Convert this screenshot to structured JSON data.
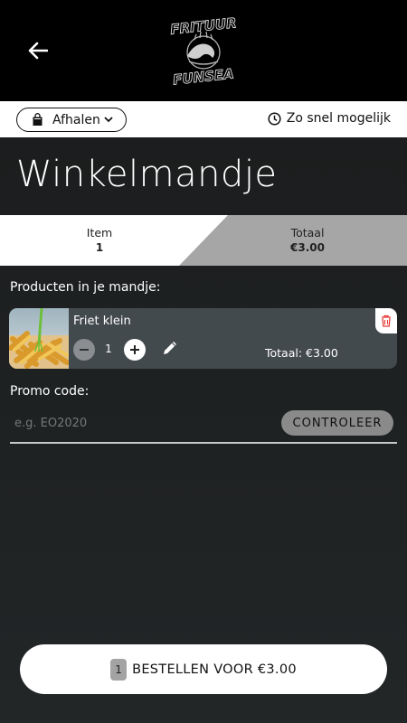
{
  "header": {
    "logo_top_text": "FRITUUR",
    "logo_bottom_text": "FUNSEA"
  },
  "options": {
    "pickup_label": "Afhalen",
    "time_label": "Zo snel mogelijk"
  },
  "page": {
    "title": "Winkelmandje"
  },
  "summary": {
    "item_label": "Item",
    "item_count": "1",
    "total_label": "Totaal",
    "total_value": "€3.00"
  },
  "products": {
    "section_label": "Producten in je mandje:",
    "items": [
      {
        "name": "Friet klein",
        "quantity": "1",
        "total": "Totaal: €3.00"
      }
    ]
  },
  "promo": {
    "label": "Promo code:",
    "placeholder": "e.g. EO2020",
    "check_label": "CONTROLEER"
  },
  "order": {
    "count": "1",
    "label": "BESTELLEN VOOR €3.00"
  },
  "colors": {
    "header_bg": "#000000",
    "strip_white": "#ffffff",
    "strip_gray": "#a6a6a6",
    "card_bg": "#434a4e",
    "delete_red": "#e53935"
  }
}
